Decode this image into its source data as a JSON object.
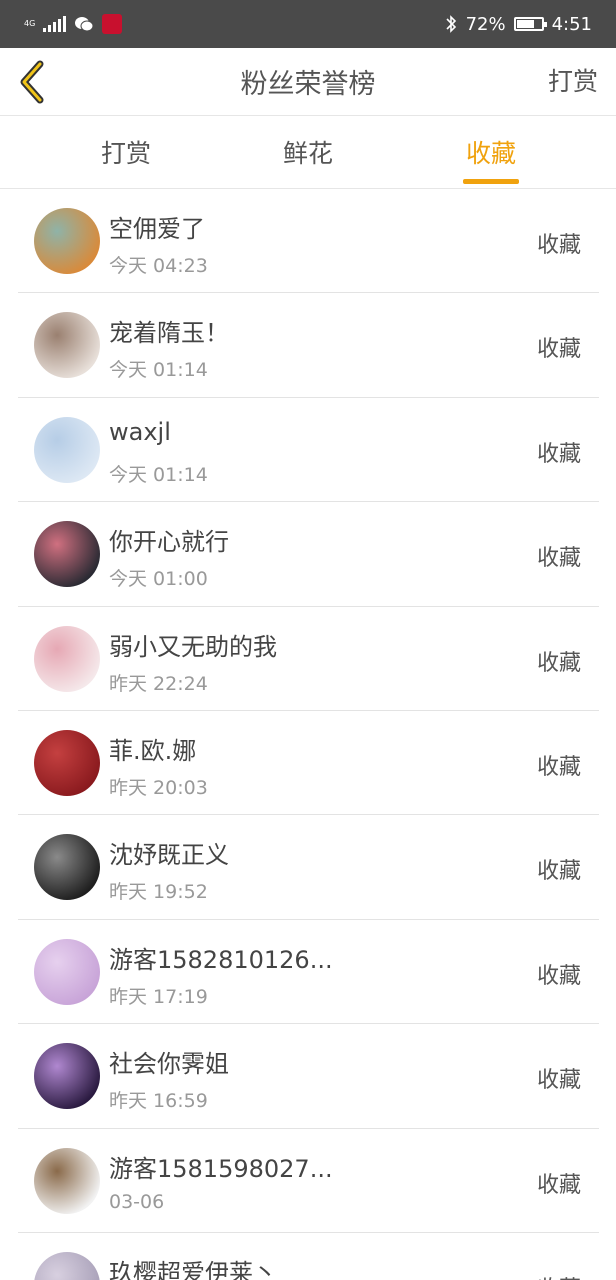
{
  "status_bar": {
    "network": "4G",
    "battery": "72%",
    "battery_level": 0.72,
    "time": "4:51",
    "icons": [
      "signal-icon",
      "wechat-icon",
      "huawei-icon",
      "bluetooth-icon",
      "battery-icon"
    ]
  },
  "header": {
    "title": "粉丝荣誉榜",
    "right_action": "打赏"
  },
  "tabs": [
    {
      "label": "打赏",
      "active": false
    },
    {
      "label": "鲜花",
      "active": false
    },
    {
      "label": "收藏",
      "active": true
    }
  ],
  "colors": {
    "accent": "#f0a20e",
    "status_bar": "#4a4a4a",
    "divider": "#e3e3e3"
  },
  "items": [
    {
      "name": "空佣爱了",
      "time": "今天 04:23",
      "action": "收藏",
      "avatar_colors": [
        "#d98a3a",
        "#8fb3a8"
      ]
    },
    {
      "name": "宠着隋玉！",
      "time": "今天 01:14",
      "action": "收藏",
      "avatar_colors": [
        "#e8e0da",
        "#9a8070"
      ]
    },
    {
      "name": "waxjl",
      "time": "今天 01:14",
      "action": "收藏",
      "avatar_colors": [
        "#dde8f4",
        "#b6cde6"
      ]
    },
    {
      "name": "你开心就行",
      "time": "今天 01:00",
      "action": "收藏",
      "avatar_colors": [
        "#2a2a33",
        "#d07080"
      ]
    },
    {
      "name": "弱小又无助的我",
      "time": "昨天 22:24",
      "action": "收藏",
      "avatar_colors": [
        "#f5e8ea",
        "#e6a8b4"
      ]
    },
    {
      "name": "菲.欧.娜",
      "time": "昨天 20:03",
      "action": "收藏",
      "avatar_colors": [
        "#8a1a1e",
        "#c44040"
      ]
    },
    {
      "name": "沈妤既正义",
      "time": "昨天 19:52",
      "action": "收藏",
      "avatar_colors": [
        "#1e1e1e",
        "#8a8a8a"
      ]
    },
    {
      "name": "游客1582810126...",
      "time": "昨天 17:19",
      "action": "收藏",
      "avatar_colors": [
        "#c8a4d8",
        "#e6d0ee"
      ]
    },
    {
      "name": "社会你霁姐",
      "time": "昨天 16:59",
      "action": "收藏",
      "avatar_colors": [
        "#2a1a40",
        "#b088d0"
      ]
    },
    {
      "name": "游客1581598027...",
      "time": "03-06",
      "action": "收藏",
      "avatar_colors": [
        "#f2f2f2",
        "#8a6a4a"
      ]
    },
    {
      "name": "玖樱超爱伊莱丶",
      "time": "",
      "action": "收藏",
      "avatar_colors": [
        "#a8a0b8",
        "#d8d0e0"
      ]
    }
  ]
}
